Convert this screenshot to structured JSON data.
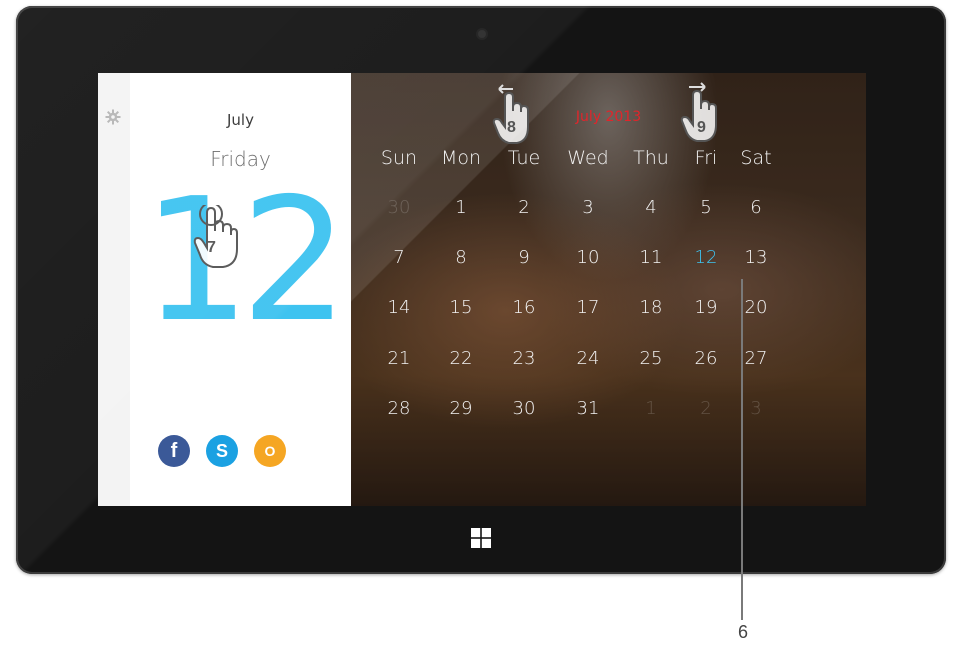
{
  "left_panel": {
    "month": "July",
    "weekday": "Friday",
    "day_number": "12",
    "icons": [
      "gear-icon",
      "facebook-icon",
      "skype-icon",
      "outlook-icon"
    ],
    "social": {
      "facebook": "f",
      "skype": "S",
      "outlook": "O"
    }
  },
  "calendar": {
    "title": "July 2013",
    "title_color": "#e0252b",
    "accent": "#3ec3f0",
    "weekdays": [
      "Sun",
      "Mon",
      "Tue",
      "Wed",
      "Thu",
      "Fri",
      "Sat"
    ],
    "weeks": [
      [
        "30",
        "1",
        "2",
        "3",
        "4",
        "5",
        "6"
      ],
      [
        "7",
        "8",
        "9",
        "10",
        "11",
        "12",
        "13"
      ],
      [
        "14",
        "15",
        "16",
        "17",
        "18",
        "19",
        "20"
      ],
      [
        "21",
        "22",
        "23",
        "24",
        "25",
        "26",
        "27"
      ],
      [
        "28",
        "29",
        "30",
        "31",
        "1",
        "2",
        "3"
      ]
    ],
    "selected": "12"
  },
  "gestures": {
    "tap_label": "7",
    "swipe_left_label": "8",
    "swipe_right_label": "9"
  },
  "callout": {
    "label": "6"
  }
}
